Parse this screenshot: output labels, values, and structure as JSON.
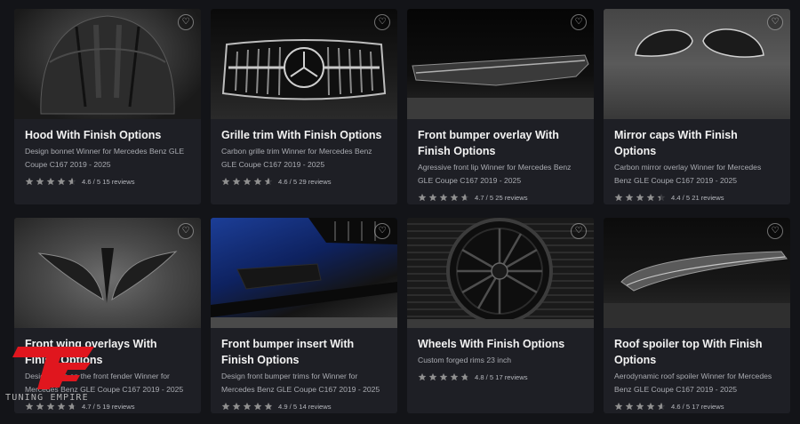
{
  "products": [
    {
      "title": "Hood With Finish Options",
      "desc": "Design bonnet Winner for Mercedes Benz GLE Coupe C167 2019 - 2025",
      "rating_text": "4.6 / 5 15 reviews",
      "rating": 4.6,
      "image": "hood"
    },
    {
      "title": "Grille trim With Finish Options",
      "desc": "Carbon grille trim Winner for Mercedes Benz GLE Coupe C167 2019 - 2025",
      "rating_text": "4.6 / 5 29 reviews",
      "rating": 4.6,
      "image": "grille"
    },
    {
      "title": "Front bumper overlay With Finish Options",
      "desc": "Agressive front lip Winner for Mercedes Benz GLE Coupe C167 2019 - 2025",
      "rating_text": "4.7 / 5 25 reviews",
      "rating": 4.7,
      "image": "bumper"
    },
    {
      "title": "Mirror caps With Finish Options",
      "desc": "Carbon mirror overlay Winner for Mercedes Benz GLE Coupe C167 2019 - 2025",
      "rating_text": "4.4 / 5 21 reviews",
      "rating": 4.4,
      "image": "mirror"
    },
    {
      "title": "Front wing overlays With Finish Options",
      "desc": "Design parts on the front fender Winner for Mercedes Benz GLE Coupe C167 2019 - 2025",
      "rating_text": "4.7 / 5 19 reviews",
      "rating": 4.7,
      "image": "wing"
    },
    {
      "title": "Front bumper insert With Finish Options",
      "desc": "Design front bumper trims for Winner for Mercedes Benz GLE Coupe C167 2019 - 2025",
      "rating_text": "4.9 / 5 14 reviews",
      "rating": 4.9,
      "image": "insert"
    },
    {
      "title": "Wheels With Finish Options",
      "desc": "Custom forged rims 23 inch",
      "rating_text": "4.8 / 5 17 reviews",
      "rating": 4.8,
      "image": "wheel"
    },
    {
      "title": "Roof spoiler top With Finish Options",
      "desc": "Aerodynamic roof spoiler Winner for Mercedes Benz GLE Coupe C167 2019 - 2025",
      "rating_text": "4.6 / 5 17 reviews",
      "rating": 4.6,
      "image": "spoiler"
    }
  ],
  "logo": {
    "brand_text": "TUNING EMPIRE",
    "monogram": "TE"
  },
  "colors": {
    "star": "#8f8f8f",
    "logo_red": "#e0161e",
    "title": "#f2f2f2",
    "card": "#1e1f25",
    "bg": "#131418"
  },
  "icons": {
    "favorite": "heart-icon",
    "rating": "star-icon"
  }
}
